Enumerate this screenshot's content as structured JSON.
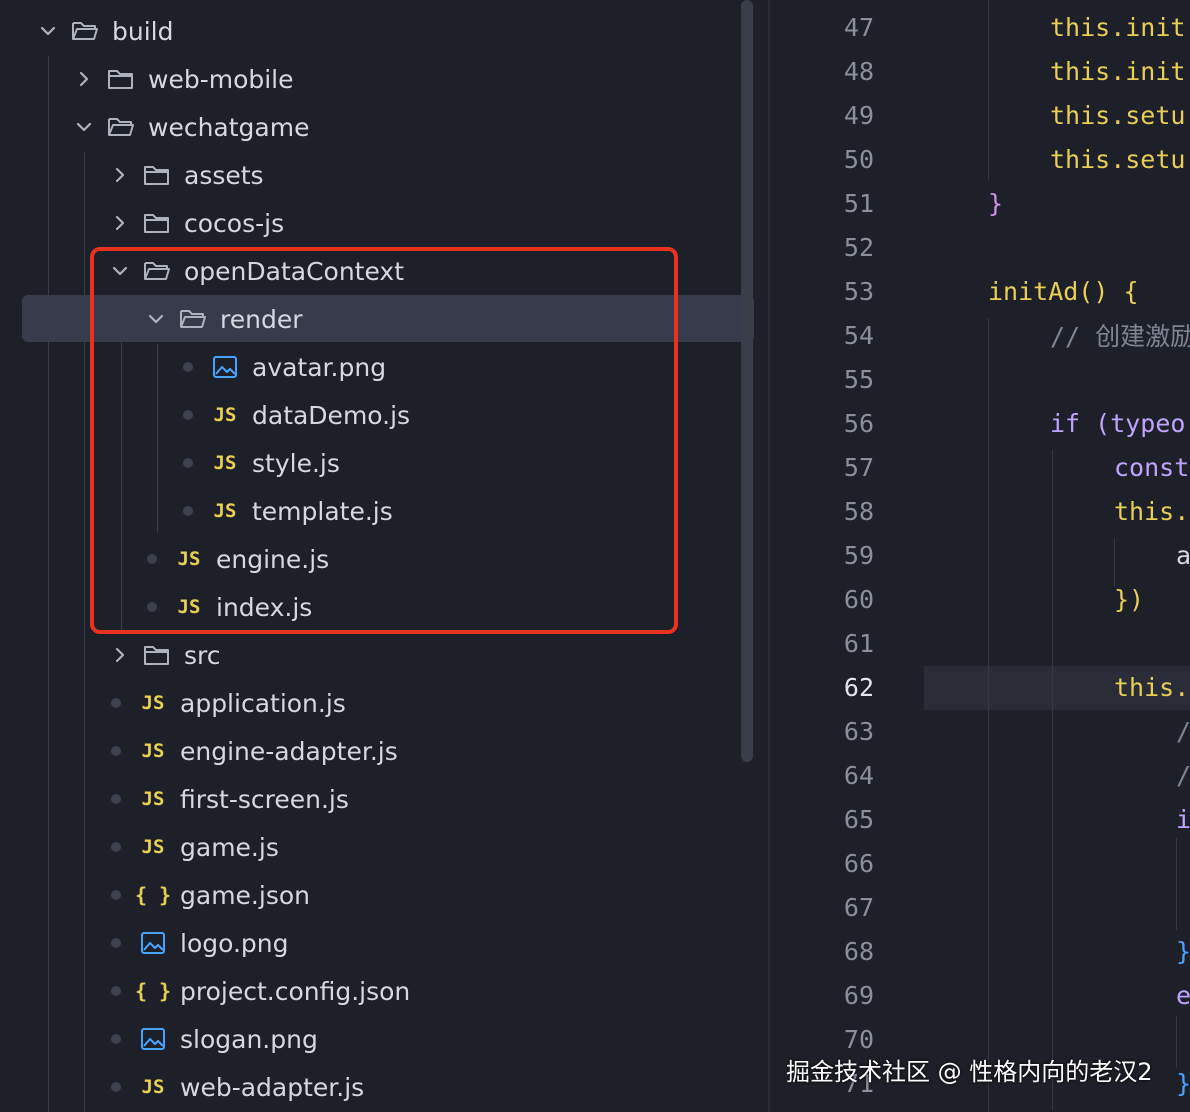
{
  "explorer": {
    "items": [
      {
        "label": "build",
        "type": "folder",
        "expanded": true
      },
      {
        "label": "web-mobile",
        "type": "folder",
        "expanded": false
      },
      {
        "label": "wechatgame",
        "type": "folder",
        "expanded": true
      },
      {
        "label": "assets",
        "type": "folder",
        "expanded": false
      },
      {
        "label": "cocos-js",
        "type": "folder",
        "expanded": false
      },
      {
        "label": "openDataContext",
        "type": "folder",
        "expanded": true
      },
      {
        "label": "render",
        "type": "folder",
        "expanded": true
      },
      {
        "label": "avatar.png",
        "type": "image"
      },
      {
        "label": "dataDemo.js",
        "type": "js"
      },
      {
        "label": "style.js",
        "type": "js"
      },
      {
        "label": "template.js",
        "type": "js"
      },
      {
        "label": "engine.js",
        "type": "js"
      },
      {
        "label": "index.js",
        "type": "js"
      },
      {
        "label": "src",
        "type": "folder",
        "expanded": false
      },
      {
        "label": "application.js",
        "type": "js"
      },
      {
        "label": "engine-adapter.js",
        "type": "js"
      },
      {
        "label": "first-screen.js",
        "type": "js"
      },
      {
        "label": "game.js",
        "type": "js"
      },
      {
        "label": "game.json",
        "type": "json"
      },
      {
        "label": "logo.png",
        "type": "image"
      },
      {
        "label": "project.config.json",
        "type": "json"
      },
      {
        "label": "slogan.png",
        "type": "image"
      },
      {
        "label": "web-adapter.js",
        "type": "js"
      }
    ],
    "js_badge": "JS",
    "json_badge": "{ }",
    "selected_item": "render",
    "highlight_color": "#e8321f"
  },
  "editor": {
    "active_line": "62",
    "lines": [
      {
        "num": "47",
        "code": "this.init"
      },
      {
        "num": "48",
        "code": "this.init"
      },
      {
        "num": "49",
        "code": "this.setu"
      },
      {
        "num": "50",
        "code": "this.setu"
      },
      {
        "num": "51",
        "code": "}"
      },
      {
        "num": "52",
        "code": ""
      },
      {
        "num": "53",
        "code": "initAd() {"
      },
      {
        "num": "54",
        "code": "// 创建激励"
      },
      {
        "num": "55",
        "code": ""
      },
      {
        "num": "56",
        "code": "if (typeo"
      },
      {
        "num": "57",
        "code": "const"
      },
      {
        "num": "58",
        "code": "this."
      },
      {
        "num": "59",
        "code": "a"
      },
      {
        "num": "60",
        "code": "})"
      },
      {
        "num": "61",
        "code": ""
      },
      {
        "num": "62",
        "code": "this."
      },
      {
        "num": "63",
        "code": "/"
      },
      {
        "num": "64",
        "code": "/"
      },
      {
        "num": "65",
        "code": "i"
      },
      {
        "num": "66",
        "code": ""
      },
      {
        "num": "67",
        "code": ""
      },
      {
        "num": "68",
        "code": "}"
      },
      {
        "num": "69",
        "code": "e"
      },
      {
        "num": "70",
        "code": ""
      },
      {
        "num": "71",
        "code": "}"
      }
    ]
  },
  "watermark": "掘金技术社区 @ 性格内向的老汉2",
  "colors": {
    "background": "#1e2029",
    "selection": "#373b4c",
    "keyword_this": "#e8cf54",
    "method": "#ff7ad2",
    "keyword": "#c0a2ff",
    "comment": "#7f8493",
    "bracket_blue": "#4aa2ff"
  },
  "icons": {
    "chevron_expanded": "chevron-down-icon",
    "chevron_collapsed": "chevron-right-icon",
    "folder_open": "folder-open-icon",
    "folder_closed": "folder-icon",
    "image": "image-file-icon",
    "js": "js-file-icon",
    "json": "json-file-icon"
  }
}
